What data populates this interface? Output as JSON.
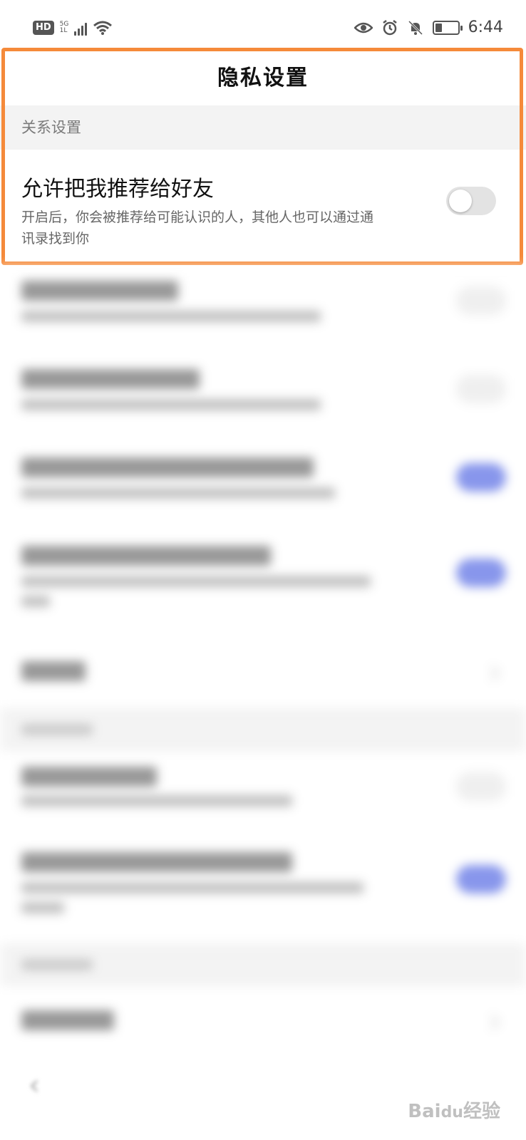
{
  "status_bar": {
    "hd_badge": "HD",
    "network": "5G",
    "network_sub": "1L",
    "time": "6:44",
    "icons": [
      "eye-icon",
      "alarm-icon",
      "bell-off-icon",
      "battery-icon"
    ]
  },
  "header": {
    "title": "隐私设置"
  },
  "section_relations": {
    "label": "关系设置",
    "item": {
      "title": "允许把我推荐给好友",
      "description": "开启后，你会被推荐给可能认识的人，其他人也可以通过通讯录找到你",
      "toggle_on": false
    }
  },
  "colors": {
    "highlight": "#f58a3a",
    "toggle_on": "#3a52e0",
    "toggle_off": "#e3e3e3"
  },
  "watermark": "Bai经验"
}
